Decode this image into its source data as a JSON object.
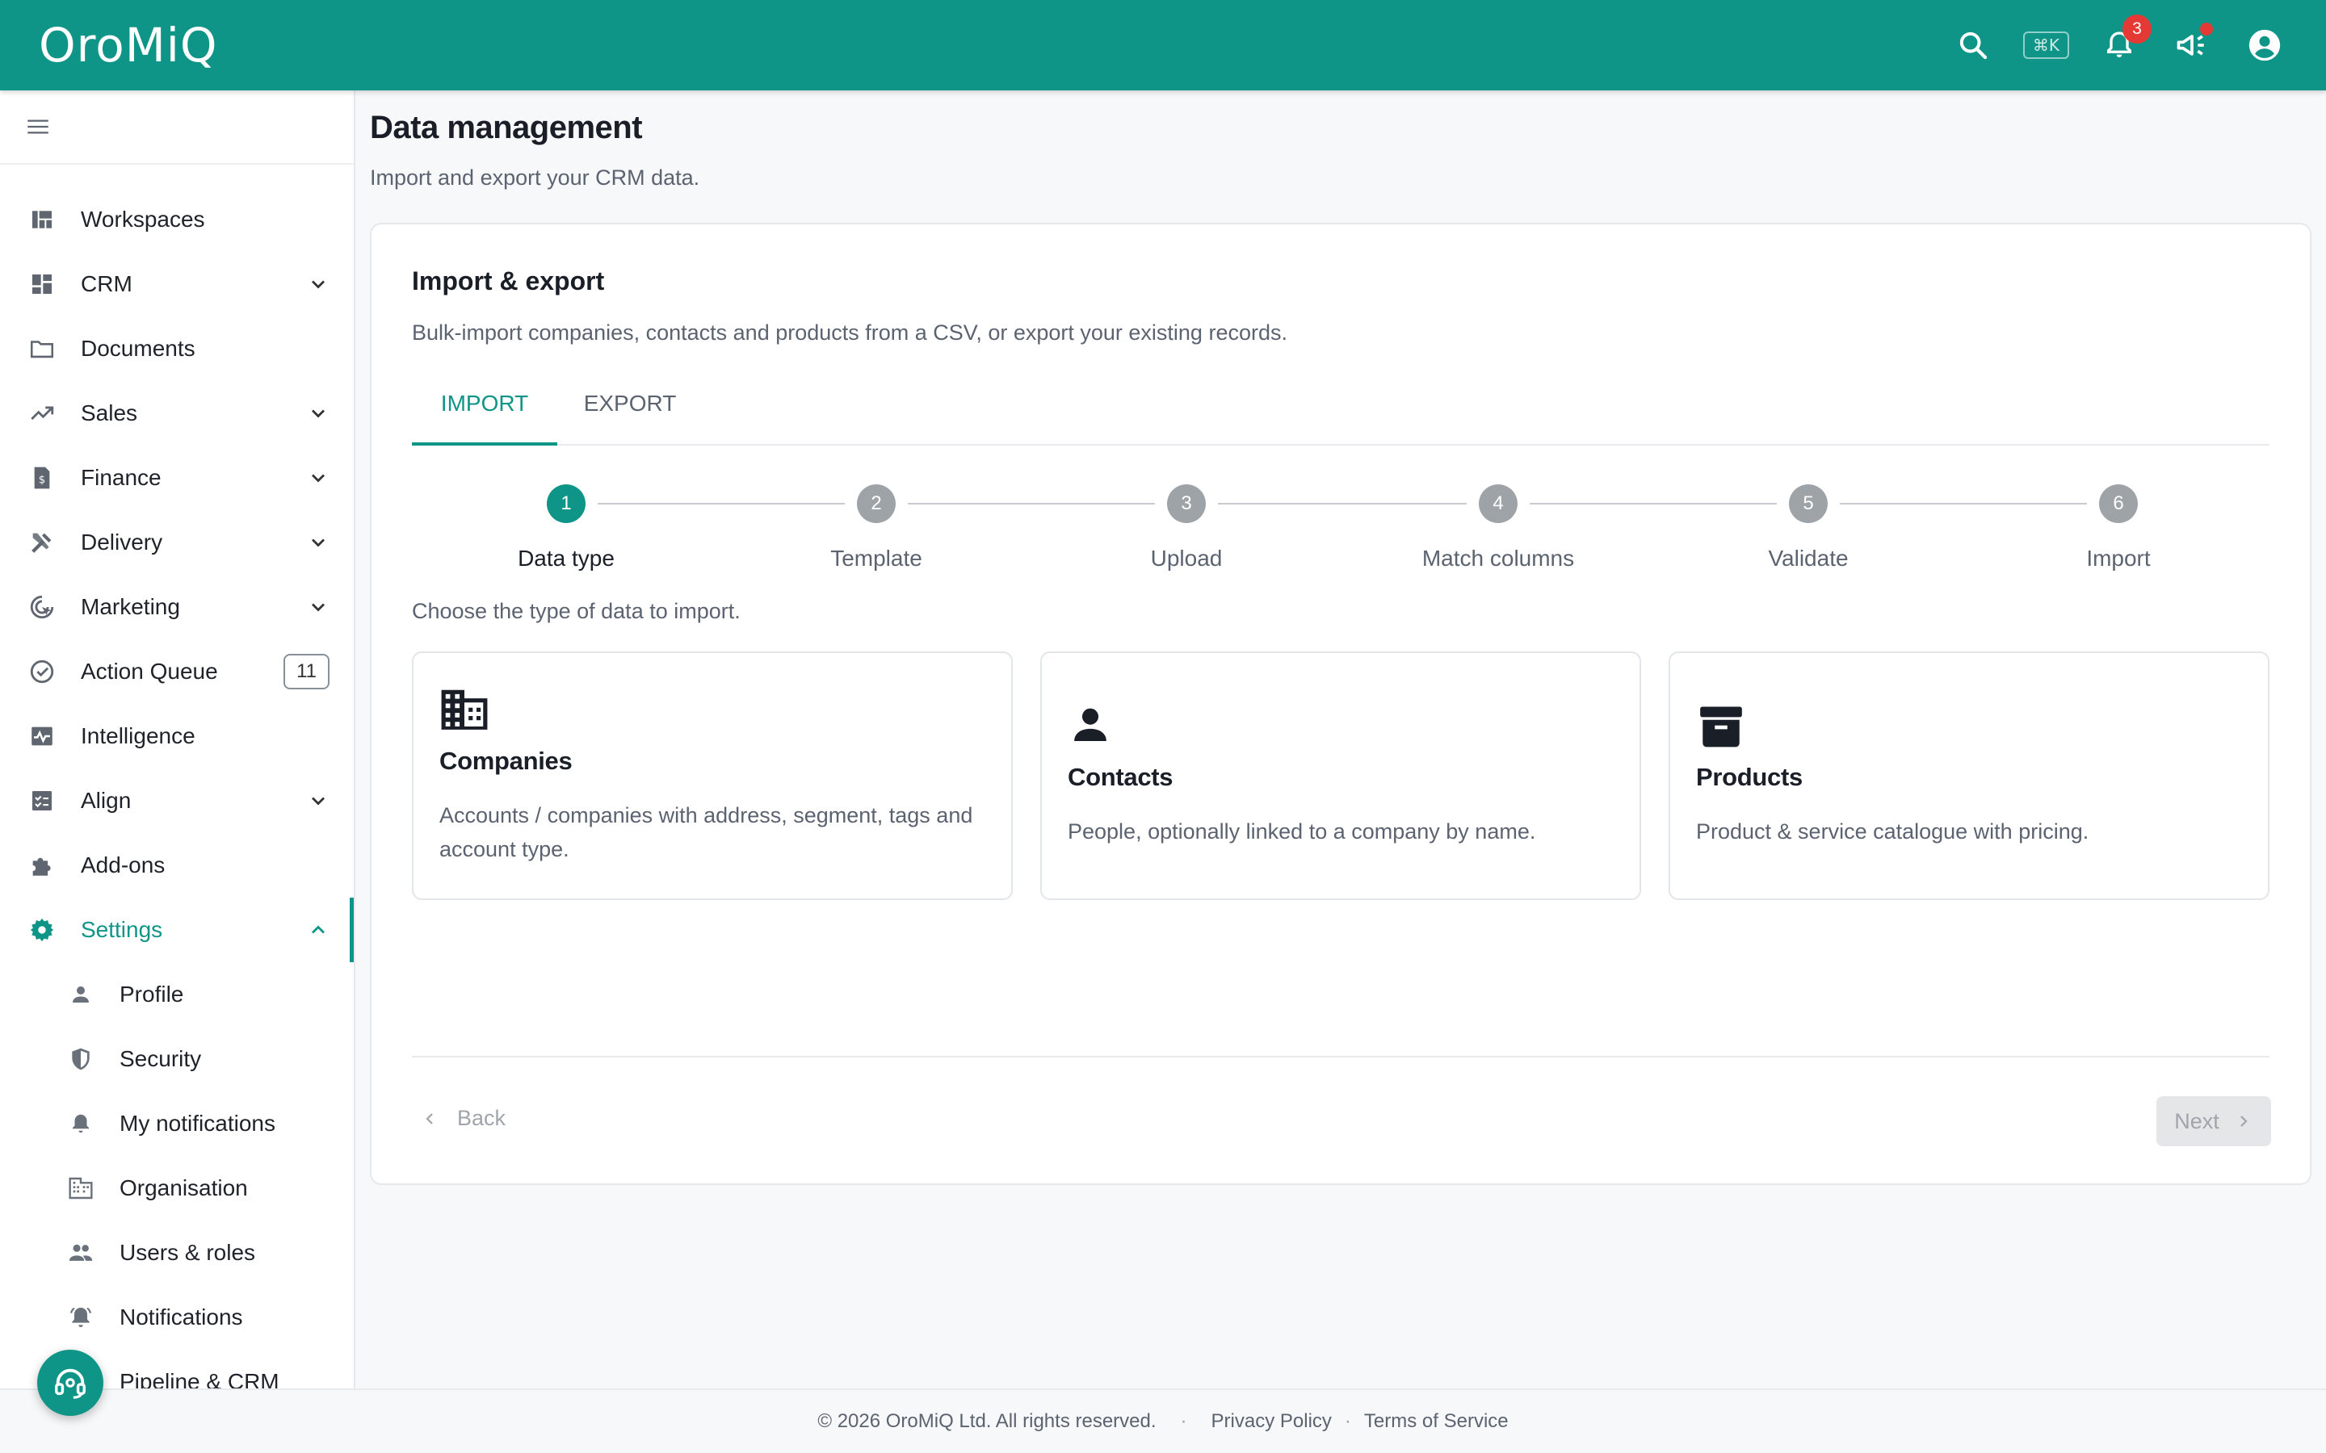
{
  "app": {
    "logo": "OroMiQ"
  },
  "topbar": {
    "shortcut": "⌘K",
    "notification_count": "3"
  },
  "sidebar": {
    "items": [
      {
        "key": "workspaces",
        "label": "Workspaces"
      },
      {
        "key": "crm",
        "label": "CRM"
      },
      {
        "key": "documents",
        "label": "Documents"
      },
      {
        "key": "sales",
        "label": "Sales"
      },
      {
        "key": "finance",
        "label": "Finance"
      },
      {
        "key": "delivery",
        "label": "Delivery"
      },
      {
        "key": "marketing",
        "label": "Marketing"
      },
      {
        "key": "action-queue",
        "label": "Action Queue",
        "badge": "11"
      },
      {
        "key": "intelligence",
        "label": "Intelligence"
      },
      {
        "key": "align",
        "label": "Align"
      },
      {
        "key": "add-ons",
        "label": "Add-ons"
      },
      {
        "key": "settings",
        "label": "Settings"
      }
    ],
    "settings_children": [
      {
        "label": "Profile"
      },
      {
        "label": "Security"
      },
      {
        "label": "My notifications"
      },
      {
        "label": "Organisation"
      },
      {
        "label": "Users & roles"
      },
      {
        "label": "Notifications"
      },
      {
        "label": "Pipeline & CRM"
      }
    ]
  },
  "page": {
    "title": "Data management",
    "subtitle": "Import and export your CRM data."
  },
  "card": {
    "title": "Import & export",
    "subtitle": "Bulk-import companies, contacts and products from a CSV, or export your existing records.",
    "tabs": [
      {
        "label": "IMPORT"
      },
      {
        "label": "EXPORT"
      }
    ],
    "steps": [
      {
        "num": "1",
        "label": "Data type"
      },
      {
        "num": "2",
        "label": "Template"
      },
      {
        "num": "3",
        "label": "Upload"
      },
      {
        "num": "4",
        "label": "Match columns"
      },
      {
        "num": "5",
        "label": "Validate"
      },
      {
        "num": "6",
        "label": "Import"
      }
    ],
    "choose_prompt": "Choose the type of data to import.",
    "types": [
      {
        "title": "Companies",
        "desc": "Accounts / companies with address, segment, tags and account type.",
        "icon": "building-icon"
      },
      {
        "title": "Contacts",
        "desc": "People, optionally linked to a company by name.",
        "icon": "person-icon"
      },
      {
        "title": "Products",
        "desc": "Product & service catalogue with pricing.",
        "icon": "archive-icon"
      }
    ],
    "back_label": "Back",
    "next_label": "Next"
  },
  "footer": {
    "copyright": "© 2026 OroMiQ Ltd. All rights reserved.",
    "privacy": "Privacy Policy",
    "terms": "Terms of Service",
    "separator": "·"
  },
  "colors": {
    "brand": "#0f9587",
    "alert": "#e53935"
  }
}
